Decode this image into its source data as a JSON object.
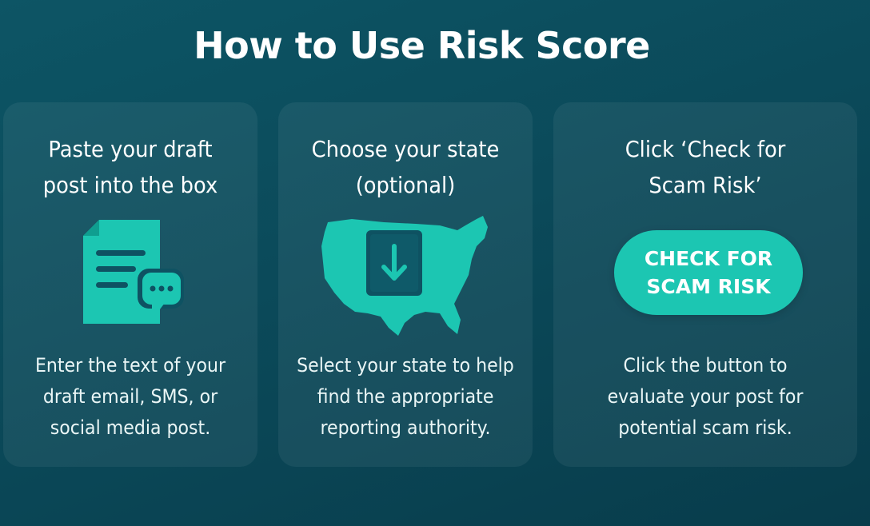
{
  "page": {
    "title": "How to Use Risk Score"
  },
  "steps": [
    {
      "title_lines": [
        "Paste your draft",
        "post into the box"
      ],
      "icon": "document-with-chat-icon",
      "desc_lines": [
        "Enter the text of your",
        "draft email, SMS, or",
        "social media post."
      ]
    },
    {
      "title_lines": [
        "Choose your state",
        "(optional)"
      ],
      "icon": "us-map-download-icon",
      "desc_lines": [
        "Select your state to help",
        "find the appropriate",
        "reporting authority."
      ]
    },
    {
      "title_lines": [
        "Click ‘Check for",
        "Scam Risk’"
      ],
      "button_lines": [
        "CHECK FOR",
        "SCAM RISK"
      ],
      "desc_lines": [
        "Click the button to",
        "evaluate your post for",
        "potential scam risk."
      ]
    }
  ],
  "colors": {
    "background": "#0b4a5a",
    "accent": "#1cc6b2",
    "card": "#1a5b6a"
  }
}
